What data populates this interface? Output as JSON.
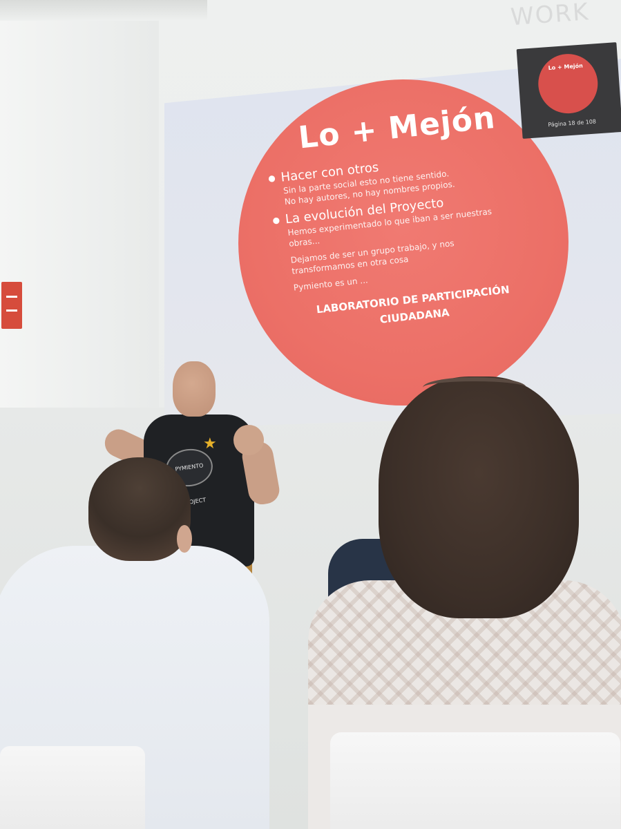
{
  "slide": {
    "title": "Lo + Mejón",
    "bullet_1": "Hacer con otros",
    "bullet_1_lines": [
      "Sin la parte social esto no tiene sentido.",
      "No hay autores, no hay nombres propios."
    ],
    "bullet_2": "La evolución del Proyecto",
    "bullet_2_lines": [
      "Hemos experimentado lo que iban a ser nuestras",
      "obras...",
      "Dejamos de ser un grupo trabajo, y nos",
      "transformamos en otra cosa",
      "Pymiento es un ..."
    ],
    "closing_line_1": "LABORATORIO DE PARTICIPACIÓN",
    "closing_line_2": "CIUDADANA",
    "accent_color": "#ec7067"
  },
  "presenter_view": {
    "title": "Lo + Mejón",
    "caption": "Página 18 de 108"
  },
  "speaker_shirt_logo": "PYMIENTO PROJECT"
}
